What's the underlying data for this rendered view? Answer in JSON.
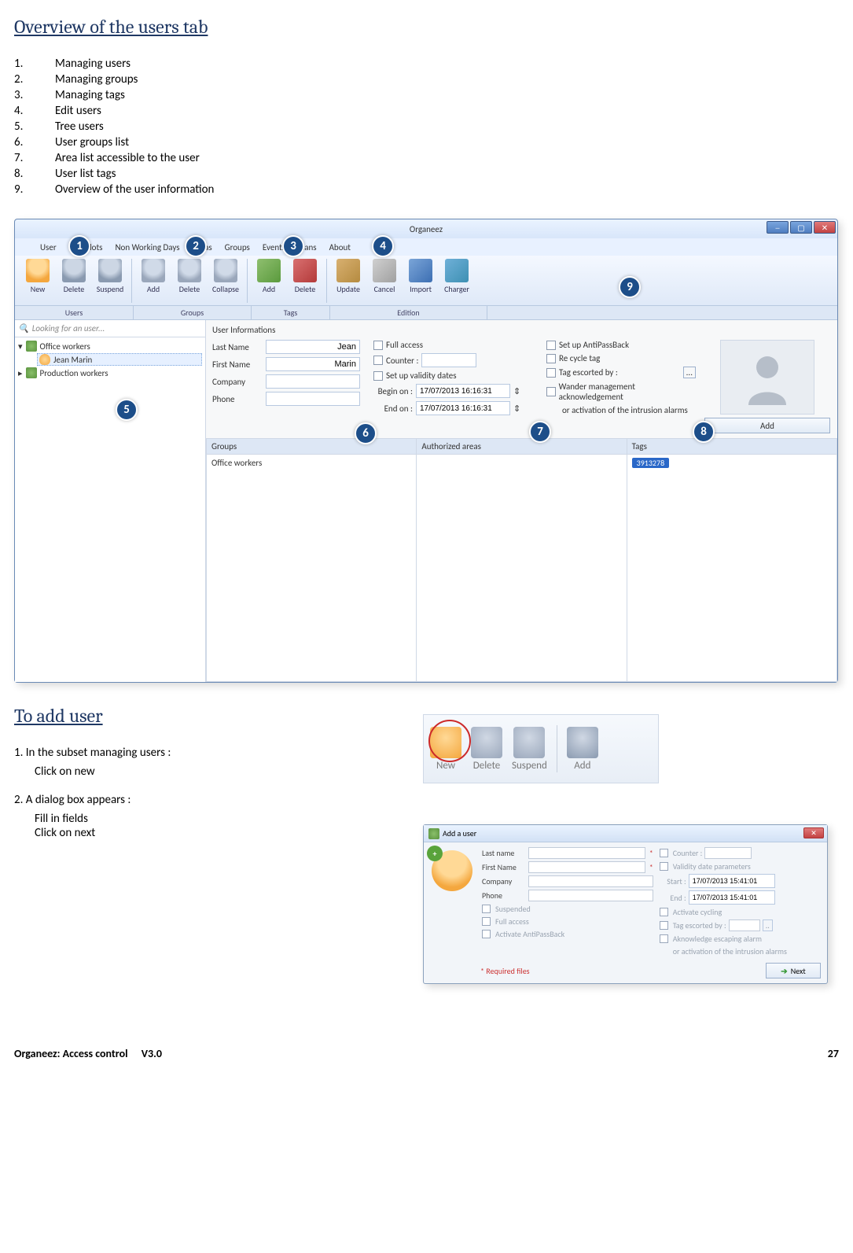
{
  "section1_title": "Overview of the users tab",
  "points": [
    "Managing users",
    "Managing groups",
    "Managing tags",
    "Edit users",
    "Tree users",
    "User groups list",
    "Area list accessible to the user",
    "User list tags",
    "Overview of the user information"
  ],
  "app": {
    "title": "Organeez",
    "menu": [
      "User",
      "Timeslots",
      "Non Working Days",
      "Areas",
      "Groups",
      "Events",
      "Plans",
      "About"
    ],
    "ribbon": {
      "users": {
        "new": "New",
        "del": "Delete",
        "susp": "Suspend"
      },
      "groups": {
        "add": "Add",
        "del": "Delete",
        "collapse": "Collapse"
      },
      "tags": {
        "add": "Add",
        "del": "Delete"
      },
      "edition": {
        "update": "Update",
        "cancel": "Cancel",
        "import": "Import",
        "charger": "Charger"
      },
      "group_labels": [
        "Users",
        "Groups",
        "Tags",
        "Edition"
      ]
    },
    "search_placeholder": "Looking for an user...",
    "tree": {
      "root1": "Office workers",
      "child1": "Jean Marin",
      "root2": "Production workers"
    },
    "form": {
      "title": "User Informations",
      "last_name_label": "Last Name",
      "last_name": "Jean",
      "first_name_label": "First Name",
      "first_name": "Marin",
      "company_label": "Company",
      "company": "",
      "phone_label": "Phone",
      "phone": "",
      "full_access": "Full access",
      "counter": "Counter :",
      "set_validity": "Set up validity dates",
      "begin_label": "Begin on :",
      "begin": "17/07/2013 16:16:31",
      "end_label": "End on :",
      "end": "17/07/2013 16:16:31",
      "antipassback": "Set up AntiPassBack",
      "recycle": "Re cycle tag",
      "escorted": "Tag escorted by :",
      "wander": "Wander management acknowledgement",
      "intrusion": "or activation of the intrusion alarms",
      "add_photo": "Add"
    },
    "lists": {
      "groups_h": "Groups",
      "groups_item": "Office workers",
      "areas_h": "Authorized areas",
      "tags_h": "Tags",
      "tag_value": "3913278"
    }
  },
  "callouts": [
    "1",
    "2",
    "3",
    "4",
    "5",
    "6",
    "7",
    "8",
    "9"
  ],
  "section2_title": "To add user",
  "step1": "1. In the subset managing users :",
  "step1_action": "Click on new",
  "step2": "2. A dialog box appears :",
  "step2_a": "Fill in fields",
  "step2_b": "Click on next",
  "toolbar_thumb": {
    "new": "New",
    "del": "Delete",
    "susp": "Suspend",
    "add": "Add"
  },
  "dialog": {
    "title": "Add a user",
    "last_name": "Last name",
    "first_name": "First Name",
    "company": "Company",
    "phone": "Phone",
    "suspended": "Suspended",
    "full_access": "Full access",
    "antipass": "Activate AntiPassBack",
    "counter": "Counter :",
    "validity": "Validity date parameters",
    "start_label": "Start :",
    "start_val": "17/07/2013 15:41:01",
    "end_label": "End :",
    "end_val": "17/07/2013 15:41:01",
    "cycling": "Activate cycling",
    "escorted": "Tag escorted by :",
    "ack": "Aknowledge escaping alarm",
    "intr": "or activation of the intrusion alarms",
    "required": "* Required files",
    "next": "Next"
  },
  "footer_left": "Organeez: Access control  V3.0",
  "footer_right": "27"
}
